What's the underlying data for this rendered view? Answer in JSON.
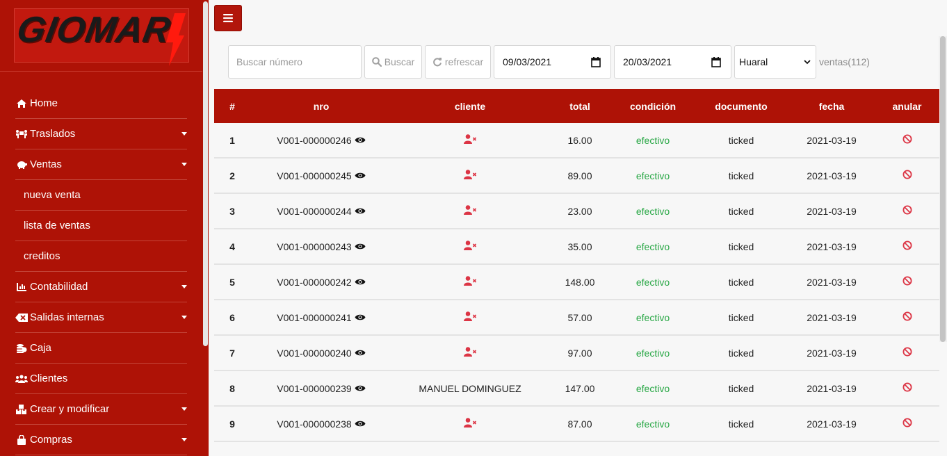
{
  "sidebar": {
    "logo_text": "GIOMAR",
    "items": [
      {
        "label": "Home",
        "icon": "home-icon",
        "expandable": false
      },
      {
        "label": "Traslados",
        "icon": "people-carry-icon",
        "expandable": true
      },
      {
        "label": "Ventas",
        "icon": "piggy-bank-icon",
        "expandable": true
      },
      {
        "label": "nueva venta",
        "icon": "",
        "expandable": false
      },
      {
        "label": "lista de ventas",
        "icon": "",
        "expandable": false
      },
      {
        "label": "creditos",
        "icon": "",
        "expandable": false
      },
      {
        "label": "Contabilidad",
        "icon": "chart-bar-icon",
        "expandable": true
      },
      {
        "label": "Salidas internas",
        "icon": "backspace-icon",
        "expandable": true
      },
      {
        "label": "Caja",
        "icon": "coins-icon",
        "expandable": false
      },
      {
        "label": "Clientes",
        "icon": "users-icon",
        "expandable": false
      },
      {
        "label": "Crear y modificar",
        "icon": "boxes-icon",
        "expandable": true
      },
      {
        "label": "Compras",
        "icon": "shopping-bag-icon",
        "expandable": true
      }
    ]
  },
  "filters": {
    "search_placeholder": "Buscar número",
    "search_button": "Buscar",
    "refresh_button": "refrescar",
    "date_from": "09/03/2021",
    "date_to": "20/03/2021",
    "store": "Huaral",
    "count_label": "ventas(112)"
  },
  "table": {
    "headers": {
      "num": "#",
      "nro": "nro",
      "cliente": "cliente",
      "total": "total",
      "condicion": "condición",
      "documento": "documento",
      "fecha": "fecha",
      "anular": "anular"
    },
    "rows": [
      {
        "num": "1",
        "nro": "V001-000000246",
        "cliente": "",
        "total": "16.00",
        "condicion": "efectivo",
        "documento": "ticked",
        "fecha": "2021-03-19"
      },
      {
        "num": "2",
        "nro": "V001-000000245",
        "cliente": "",
        "total": "89.00",
        "condicion": "efectivo",
        "documento": "ticked",
        "fecha": "2021-03-19"
      },
      {
        "num": "3",
        "nro": "V001-000000244",
        "cliente": "",
        "total": "23.00",
        "condicion": "efectivo",
        "documento": "ticked",
        "fecha": "2021-03-19"
      },
      {
        "num": "4",
        "nro": "V001-000000243",
        "cliente": "",
        "total": "35.00",
        "condicion": "efectivo",
        "documento": "ticked",
        "fecha": "2021-03-19"
      },
      {
        "num": "5",
        "nro": "V001-000000242",
        "cliente": "",
        "total": "148.00",
        "condicion": "efectivo",
        "documento": "ticked",
        "fecha": "2021-03-19"
      },
      {
        "num": "6",
        "nro": "V001-000000241",
        "cliente": "",
        "total": "57.00",
        "condicion": "efectivo",
        "documento": "ticked",
        "fecha": "2021-03-19"
      },
      {
        "num": "7",
        "nro": "V001-000000240",
        "cliente": "",
        "total": "97.00",
        "condicion": "efectivo",
        "documento": "ticked",
        "fecha": "2021-03-19"
      },
      {
        "num": "8",
        "nro": "V001-000000239",
        "cliente": "MANUEL DOMINGUEZ",
        "total": "147.00",
        "condicion": "efectivo",
        "documento": "ticked",
        "fecha": "2021-03-19"
      },
      {
        "num": "9",
        "nro": "V001-000000238",
        "cliente": "",
        "total": "87.00",
        "condicion": "efectivo",
        "documento": "ticked",
        "fecha": "2021-03-19"
      }
    ]
  },
  "colors": {
    "brand": "#ae1206",
    "success": "#28a745",
    "danger": "#dc3545"
  }
}
